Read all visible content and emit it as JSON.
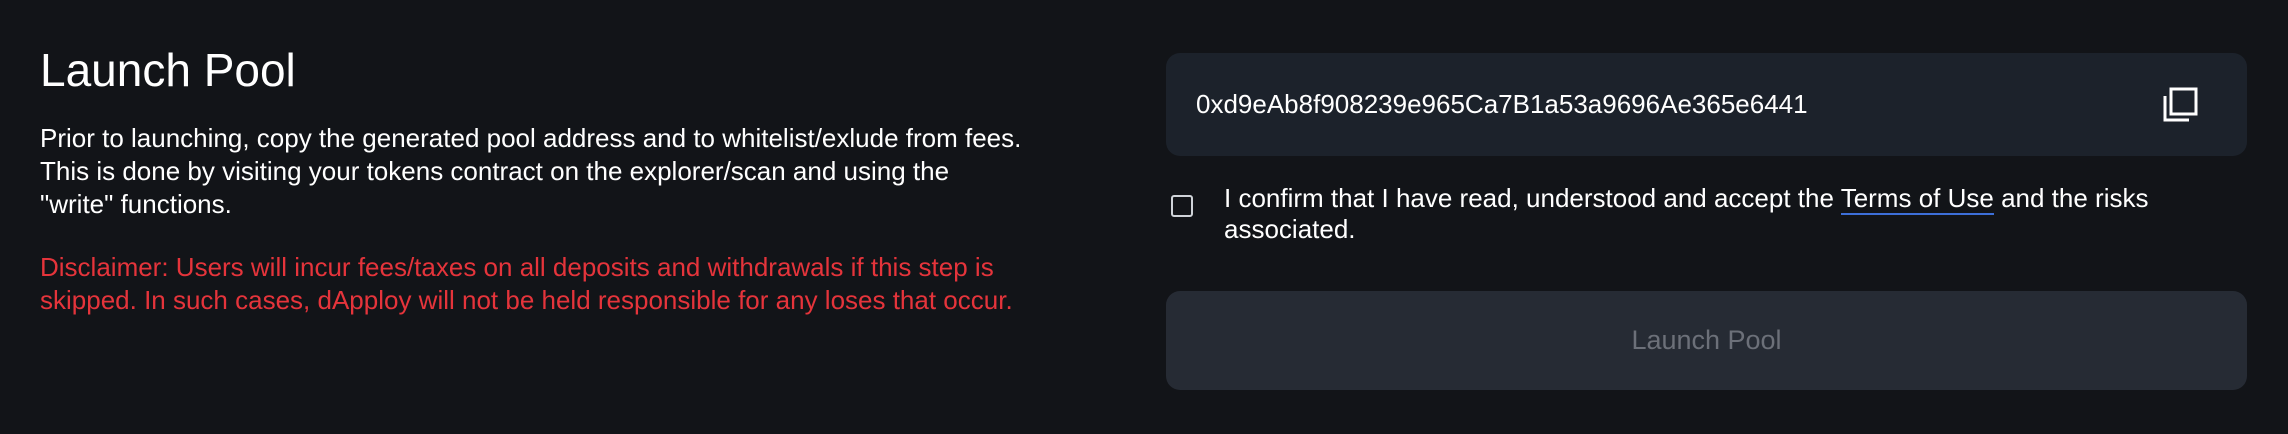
{
  "heading": "Launch Pool",
  "instructions": {
    "line1": "Prior to launching, copy the generated pool address and to whitelist/exlude from fees.",
    "line2": "This is done by visiting your tokens contract on the explorer/scan and using the",
    "line3": "\"write\" functions."
  },
  "disclaimer": {
    "line1": "Disclaimer: Users will incur fees/taxes on all deposits and withdrawals if this step is",
    "line2": "skipped. In such cases, dApploy will not be held responsible for any loses that occur."
  },
  "pool_address": "0xd9eAb8f908239e965Ca7B1a53a9696Ae365e6441",
  "confirm": {
    "text_before": "I confirm that I have read, understood and accept the ",
    "terms_link": "Terms of Use",
    "text_after": " and the risks associated.",
    "checked": false
  },
  "launch_button_label": "Launch Pool",
  "colors": {
    "background": "#121418",
    "disclaimer": "#e5343b",
    "panel": "#1c222b",
    "button_disabled": "#262b34",
    "link_underline": "#3d6fd8"
  },
  "icons": {
    "copy": "copy-icon"
  }
}
